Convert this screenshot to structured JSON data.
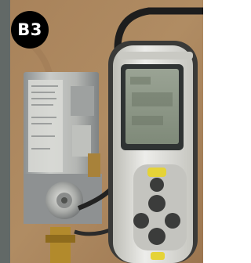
{
  "badge": {
    "label": "B3"
  }
}
